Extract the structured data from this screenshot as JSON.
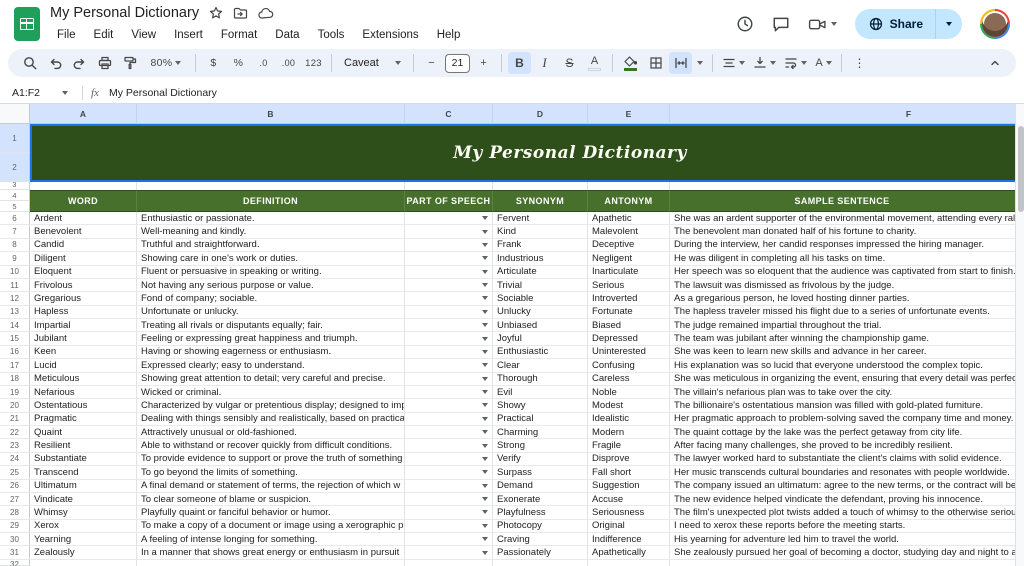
{
  "titlebar": {
    "doc_title": "My Personal Dictionary",
    "menus": [
      "File",
      "Edit",
      "View",
      "Insert",
      "Format",
      "Data",
      "Tools",
      "Extensions",
      "Help"
    ],
    "share_label": "Share"
  },
  "toolbar": {
    "zoom": "80%",
    "font": "Caveat",
    "font_size": "21",
    "glyphs": {
      "currency": "$",
      "percent": "%",
      "decrease_decimal": ".0",
      "increase_decimal": ".00",
      "more_formats": "123",
      "bold": "B",
      "italic": "I",
      "strikethrough": "S",
      "text_color": "A",
      "text_rotation": "A",
      "minus": "−",
      "plus": "+",
      "more": "⋮"
    }
  },
  "formula_bar": {
    "name_box": "A1:F2",
    "fx": "fx",
    "value": "My Personal Dictionary"
  },
  "colors": {
    "banner_green": "#2e4e1a",
    "header_green": "#46702b",
    "selection_blue": "#1a73e8",
    "selected_header_blue": "#d3e3fd",
    "share_pill_blue": "#c2e7ff"
  },
  "sheet": {
    "columns": [
      "A",
      "B",
      "C",
      "D",
      "E",
      "F"
    ],
    "banner_rows": [
      "1",
      "2"
    ],
    "row3_label": "3",
    "header_rows": [
      "4",
      "5"
    ],
    "partial_row_label": "32",
    "banner_title": "My Personal Dictionary",
    "table_headers": [
      "WORD",
      "DEFINITION",
      "PART OF SPEECH",
      "SYNONYM",
      "ANTONYM",
      "SAMPLE SENTENCE"
    ],
    "rows": [
      {
        "n": "6",
        "word": "Ardent",
        "definition": "Enthusiastic or passionate.",
        "pos": "",
        "synonym": "Fervent",
        "antonym": "Apathetic",
        "sentence": "She was an ardent supporter of the environmental movement, attending every rally"
      },
      {
        "n": "7",
        "word": "Benevolent",
        "definition": "Well-meaning and kindly.",
        "pos": "",
        "synonym": "Kind",
        "antonym": "Malevolent",
        "sentence": "The benevolent man donated half of his fortune to charity."
      },
      {
        "n": "8",
        "word": "Candid",
        "definition": "Truthful and straightforward.",
        "pos": "",
        "synonym": "Frank",
        "antonym": "Deceptive",
        "sentence": "During the interview, her candid responses impressed the hiring manager."
      },
      {
        "n": "9",
        "word": "Diligent",
        "definition": "Showing care in one's work or duties.",
        "pos": "",
        "synonym": "Industrious",
        "antonym": "Negligent",
        "sentence": "He was diligent in completing all his tasks on time."
      },
      {
        "n": "10",
        "word": "Eloquent",
        "definition": "Fluent or persuasive in speaking or writing.",
        "pos": "",
        "synonym": "Articulate",
        "antonym": "Inarticulate",
        "sentence": "Her speech was so eloquent that the audience was captivated from start to finish."
      },
      {
        "n": "11",
        "word": "Frivolous",
        "definition": "Not having any serious purpose or value.",
        "pos": "",
        "synonym": "Trivial",
        "antonym": "Serious",
        "sentence": "The lawsuit was dismissed as frivolous by the judge."
      },
      {
        "n": "12",
        "word": "Gregarious",
        "definition": "Fond of company; sociable.",
        "pos": "",
        "synonym": "Sociable",
        "antonym": "Introverted",
        "sentence": "As a gregarious person, he loved hosting dinner parties."
      },
      {
        "n": "13",
        "word": "Hapless",
        "definition": "Unfortunate or unlucky.",
        "pos": "",
        "synonym": "Unlucky",
        "antonym": "Fortunate",
        "sentence": "The hapless traveler missed his flight due to a series of unfortunate events."
      },
      {
        "n": "14",
        "word": "Impartial",
        "definition": "Treating all rivals or disputants equally; fair.",
        "pos": "",
        "synonym": "Unbiased",
        "antonym": "Biased",
        "sentence": "The judge remained impartial throughout the trial."
      },
      {
        "n": "15",
        "word": "Jubilant",
        "definition": "Feeling or expressing great happiness and triumph.",
        "pos": "",
        "synonym": "Joyful",
        "antonym": "Depressed",
        "sentence": "The team was jubilant after winning the championship game."
      },
      {
        "n": "16",
        "word": "Keen",
        "definition": "Having or showing eagerness or enthusiasm.",
        "pos": "",
        "synonym": "Enthusiastic",
        "antonym": "Uninterested",
        "sentence": "She was keen to learn new skills and advance in her career."
      },
      {
        "n": "17",
        "word": "Lucid",
        "definition": "Expressed clearly; easy to understand.",
        "pos": "",
        "synonym": "Clear",
        "antonym": "Confusing",
        "sentence": "His explanation was so lucid that everyone understood the complex topic."
      },
      {
        "n": "18",
        "word": "Meticulous",
        "definition": "Showing great attention to detail; very careful and precise.",
        "pos": "",
        "synonym": "Thorough",
        "antonym": "Careless",
        "sentence": "She was meticulous in organizing the event, ensuring that every detail was perfect"
      },
      {
        "n": "19",
        "word": "Nefarious",
        "definition": "Wicked or criminal.",
        "pos": "",
        "synonym": "Evil",
        "antonym": "Noble",
        "sentence": "The villain's nefarious plan was to take over the city."
      },
      {
        "n": "20",
        "word": "Ostentatious",
        "definition": "Characterized by vulgar or pretentious display; designed to imp",
        "pos": "",
        "synonym": "Showy",
        "antonym": "Modest",
        "sentence": "The billionaire's ostentatious mansion was filled with gold-plated furniture."
      },
      {
        "n": "21",
        "word": "Pragmatic",
        "definition": "Dealing with things sensibly and realistically, based on practica",
        "pos": "",
        "synonym": "Practical",
        "antonym": "Idealistic",
        "sentence": "Her pragmatic approach to problem-solving saved the company time and money."
      },
      {
        "n": "22",
        "word": "Quaint",
        "definition": "Attractively unusual or old-fashioned.",
        "pos": "",
        "synonym": "Charming",
        "antonym": "Modern",
        "sentence": "The quaint cottage by the lake was the perfect getaway from city life."
      },
      {
        "n": "23",
        "word": "Resilient",
        "definition": "Able to withstand or recover quickly from difficult conditions.",
        "pos": "",
        "synonym": "Strong",
        "antonym": "Fragile",
        "sentence": "After facing many challenges, she proved to be incredibly resilient."
      },
      {
        "n": "24",
        "word": "Substantiate",
        "definition": "To provide evidence to support or prove the truth of something",
        "pos": "",
        "synonym": "Verify",
        "antonym": "Disprove",
        "sentence": "The lawyer worked hard to substantiate the client's claims with solid evidence."
      },
      {
        "n": "25",
        "word": "Transcend",
        "definition": "To go beyond the limits of something.",
        "pos": "",
        "synonym": "Surpass",
        "antonym": "Fall short",
        "sentence": "Her music transcends cultural boundaries and resonates with people worldwide."
      },
      {
        "n": "26",
        "word": "Ultimatum",
        "definition": "A final demand or statement of terms, the rejection of which w",
        "pos": "",
        "synonym": "Demand",
        "antonym": "Suggestion",
        "sentence": "The company issued an ultimatum: agree to the new terms, or the contract will be"
      },
      {
        "n": "27",
        "word": "Vindicate",
        "definition": "To clear someone of blame or suspicion.",
        "pos": "",
        "synonym": "Exonerate",
        "antonym": "Accuse",
        "sentence": "The new evidence helped vindicate the defendant, proving his innocence."
      },
      {
        "n": "28",
        "word": "Whimsy",
        "definition": "Playfully quaint or fanciful behavior or humor.",
        "pos": "",
        "synonym": "Playfulness",
        "antonym": "Seriousness",
        "sentence": "The film's unexpected plot twists added a touch of whimsy to the otherwise serious"
      },
      {
        "n": "29",
        "word": "Xerox",
        "definition": "To make a copy of a document or image using a xerographic pr",
        "pos": "",
        "synonym": "Photocopy",
        "antonym": "Original",
        "sentence": "I need to xerox these reports before the meeting starts."
      },
      {
        "n": "30",
        "word": "Yearning",
        "definition": "A feeling of intense longing for something.",
        "pos": "",
        "synonym": "Craving",
        "antonym": "Indifference",
        "sentence": "His yearning for adventure led him to travel the world."
      },
      {
        "n": "31",
        "word": "Zealously",
        "definition": "In a manner that shows great energy or enthusiasm in pursuit",
        "pos": "",
        "synonym": "Passionately",
        "antonym": "Apathetically",
        "sentence": "She zealously pursued her goal of becoming a doctor, studying day and night to ac"
      }
    ]
  }
}
